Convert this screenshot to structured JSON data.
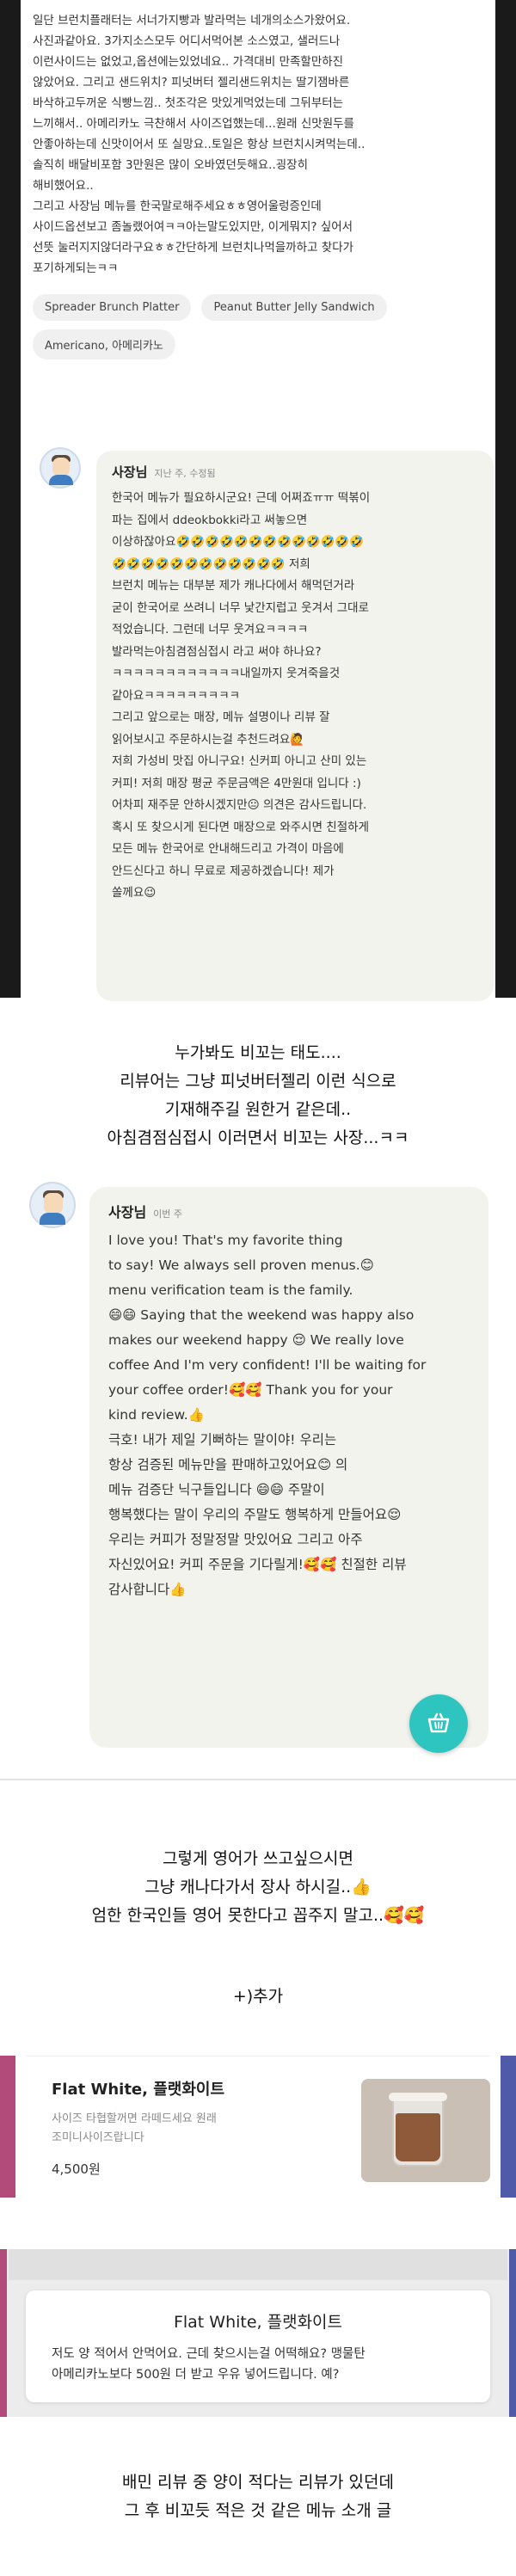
{
  "review": {
    "text": "일단 브런치플래터는 서너가지빵과 발라먹는 네개의소스가왔어요.\n사진과같아요. 3가지소스모두 어디서먹어본 소스였고, 샐러드나\n이런사이드는 없었고,옵션에는있었네요.. 가격대비 만족할만하진\n않았어요. 그리고 샌드위치? 피넛버터 젤리샌드위치는 딸기잼바른\n바삭하고두꺼운 식빵느낌.. 첫조각은 맛있게먹었는데 그뒤부터는\n느끼해서.. 아메리카노 극찬해서 사이즈업했는데...원래 신맛원두를\n안좋아하는데 신맛이어서 또 실망요..토일은 항상 브런치시켜먹는데..\n솔직히 배달비포함 3만원은 많이 오바였던듯해요..굉장히\n해비했어요..\n그리고 사장님 메뉴를 한국말로해주세요ㅎㅎ영어울렁증인데\n사이드옵션보고 좀놀랬어여ㅋㅋ아는말도있지만, 이게뭐지? 싶어서\n선뜻 눌러지지않더라구요ㅎㅎ간단하게 브런치나먹을까하고 찾다가\n포기하게되는ㅋㅋ",
    "chips": [
      "Spreader Brunch Platter",
      "Peanut Butter Jelly Sandwich",
      "Americano, 아메리카노"
    ]
  },
  "reply1": {
    "owner_name": "사장님",
    "meta": "지난 주, 수정됨",
    "text": "한국어 메뉴가 필요하시군요! 근데 어쩌죠ㅠㅠ 떡볶이\n파는 집에서 ddeokbokki라고 써놓으면\n이상하잖아요🤣🤣🤣🤣🤣🤣🤣🤣🤣🤣🤣🤣🤣\n🤣🤣🤣🤣🤣🤣🤣🤣🤣🤣🤣🤣 저희\n브런치 메뉴는 대부분 제가 캐나다에서 해먹던거라\n굳이 한국어로 쓰려니 너무 낯간지럽고 웃겨서 그대로\n적었습니다. 그런데 너무 웃겨요ㅋㅋㅋㅋ\n발라먹는아침겸점심접시 라고 써야 하나요?\nㅋㅋㅋㅋㅋㅋㅋㅋㅋㅋㅋㅋ내일까지 웃겨죽을것\n같아요ㅋㅋㅋㅋㅋㅋㅋㅋㅋ\n그리고 앞으로는 매장, 메뉴 설명이나 리뷰 잘\n읽어보시고 주문하시는걸 추천드려요🙋\n저희 가성비 맛집 아니구요! 신커피 아니고 산미 있는\n커피! 저희 매장 평균 주문금액은 4만원대 입니다 :)\n어차피 재주문 안하시겠지만😐 의견은 감사드립니다.\n혹시 또 찾으시게 된다면 매장으로 와주시면 친절하게\n모든 메뉴 한국어로 안내해드리고 가격이 마음에\n안드신다고 하니 무료로 제공하겠습니다! 제가\n쏠께요😉"
  },
  "caption1": "누가봐도 비꼬는 태도....\n리뷰어는 그냥 피넛버터젤리 이런 식으로\n기재해주길 원한거 같은데..\n아침겸점심접시 이러면서 비꼬는 사장...ㅋㅋ",
  "reply2": {
    "owner_name": "사장님",
    "meta": "이번 주",
    "text": "I love you! That's my favorite thing\nto say! We always sell proven menus.😊\nmenu verification team is the          family.\n😄😄 Saying that the weekend was happy also\nmakes our weekend happy 😌 We really love\ncoffee And I'm very confident! I'll be waiting for\nyour coffee order!🥰🥰 Thank you for your\nkind review.👍\n          극호! 내가 제일 기뻐하는 말이야! 우리는\n항상 검증된 메뉴만을 판매하고있어요😊          의\n메뉴 검증단         닉구들입니다 😄😄 주말이\n행복했다는 말이 우리의 주말도 행복하게 만들어요😌\n우리는 커피가 정말정말 맛있어요 그리고 아주\n자신있어요! 커피 주문을 기다릴게!🥰🥰 친절한 리뷰\n감사합니다👍"
  },
  "caption2": "그렇게 영어가 쓰고싶으시면\n그냥 캐나다가서 장사 하시길..👍\n엄한 한국인들 영어 못한다고 꼽주지 말고..🥰🥰",
  "caption3": "+)추가",
  "menu_item": {
    "title": "Flat White, 플랫화이트",
    "desc": "사이즈 타협할꺼면 라떼드세요 원래\n조미니사이즈랍니다",
    "price": "4,500원"
  },
  "menu_notice": {
    "title": "Flat White, 플랫화이트",
    "text": "저도 양 적어서 안먹어요. 근데 찾으시는걸 어떡해요? 맹물탄\n아메리카노보다 500원 더 받고 우유 넣어드립니다. 예?"
  },
  "caption4": "배민 리뷰 중 양이 적다는 리뷰가 있던데\n그 후 비꼬듯 적은 것 같은 메뉴 소개 글",
  "colors": {
    "dark_bg": "#1a1a1a",
    "bubble": "#f3f3ee",
    "fab": "#2ec5c0",
    "left_bar": "#b24a7a",
    "right_bar": "#4f5aa8"
  }
}
